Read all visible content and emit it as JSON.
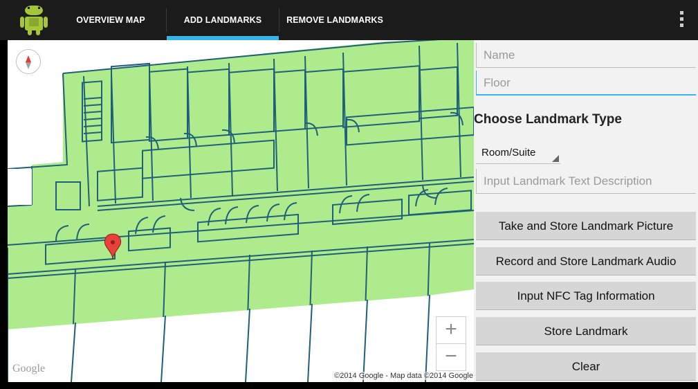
{
  "actionbar": {
    "icon": "android-robot-icon",
    "tabs": [
      {
        "label": "OVERVIEW MAP"
      },
      {
        "label": "ADD LANDMARKS"
      },
      {
        "label": "REMOVE LANDMARKS"
      }
    ],
    "selected_tab": "ADD LANDMARKS",
    "accent": "#33b5e5",
    "overflow_icon": "overflow-menu-icon"
  },
  "map": {
    "zoom_in": "+",
    "zoom_out": "−",
    "google_logo": "Google",
    "copyright": "©2014 Google - Map data ©2014 Google",
    "overlay_color": "#aeeb8c",
    "outline_color": "#1f5f78",
    "marker_color": "#e8403a"
  },
  "form": {
    "name_placeholder": "Name",
    "floor_placeholder": "Floor",
    "section_title": "Choose Landmark Type",
    "landmark_type": "Room/Suite",
    "description_placeholder": "Input Landmark Text Description",
    "buttons": {
      "picture": "Take and Store Landmark Picture",
      "audio": "Record and Store Landmark Audio",
      "nfc": "Input NFC Tag Information",
      "store": "Store Landmark",
      "clear": "Clear"
    }
  }
}
